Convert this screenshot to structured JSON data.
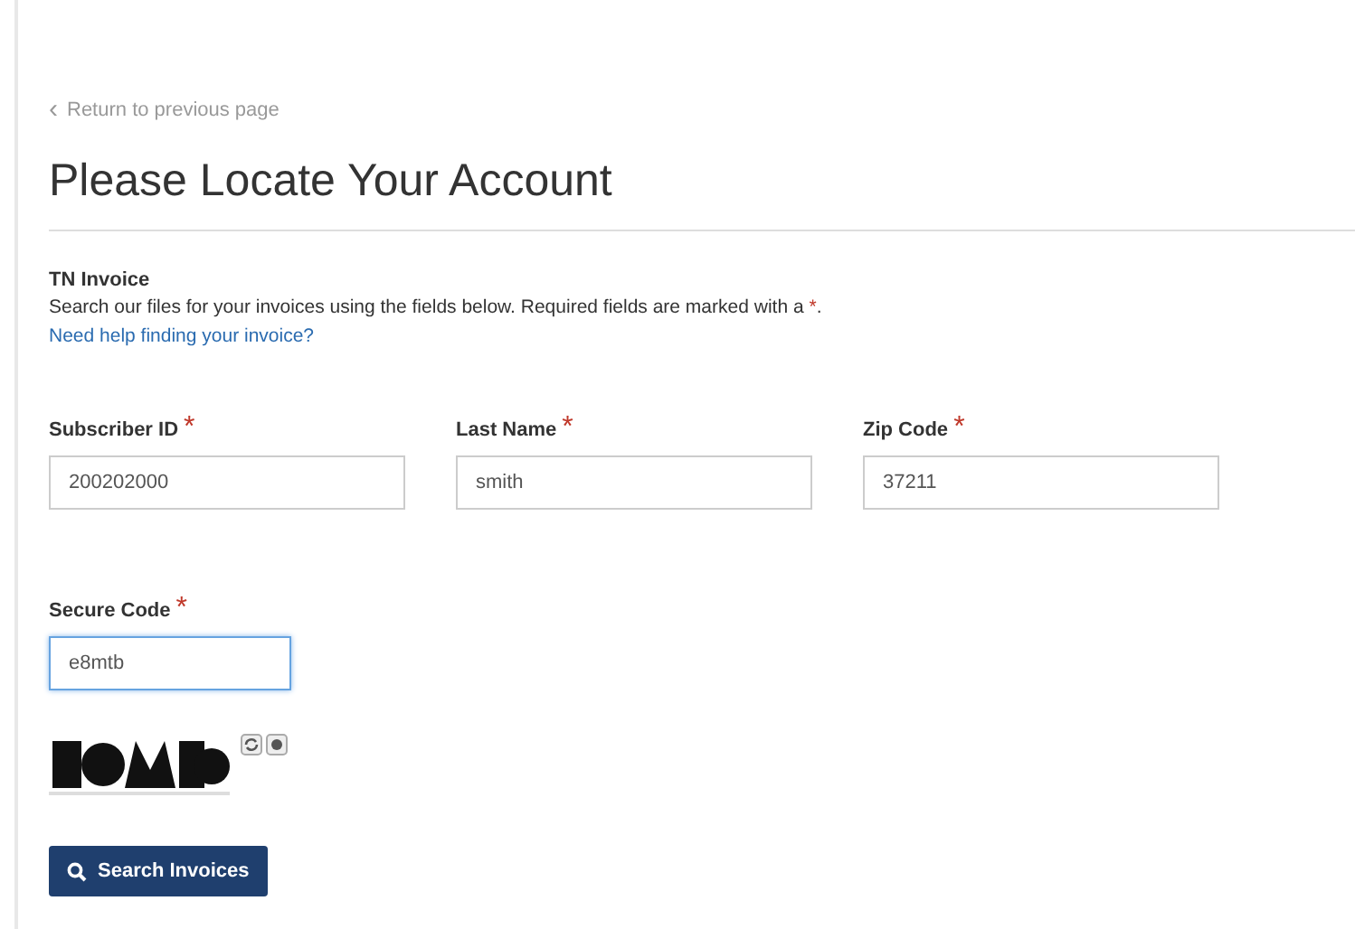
{
  "back_link": {
    "icon": "‹",
    "label": "Return to previous page"
  },
  "title": "Please Locate Your Account",
  "form": {
    "heading": "TN Invoice",
    "intro": "Search our files for your invoices using the fields below.  Required fields are marked with a ",
    "required_mark": "*",
    "intro_end": ".",
    "help_link": "Need help finding your invoice?",
    "fields": [
      {
        "label": "Subscriber ID",
        "required": true,
        "value": "200202000",
        "focused": false
      },
      {
        "label": "Last Name",
        "required": true,
        "value": "smith",
        "focused": false
      },
      {
        "label": "Zip Code",
        "required": true,
        "value": "37211",
        "focused": false
      }
    ],
    "secure_code": {
      "label": "Secure Code",
      "required": true,
      "value": "e8mtb",
      "focused": true
    },
    "button": {
      "label": "Search Invoices"
    }
  }
}
